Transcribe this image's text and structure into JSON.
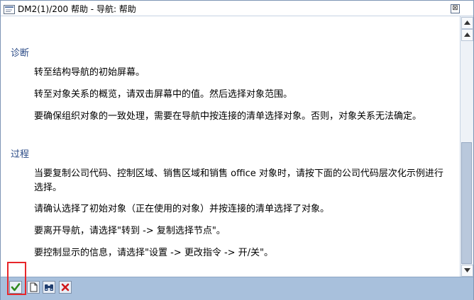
{
  "window": {
    "title": "DM2(1)/200 帮助 - 导航: 帮助",
    "close_glyph": "⊠"
  },
  "content": {
    "sections": [
      {
        "heading": "诊断",
        "paragraphs": [
          "转至结构导航的初始屏幕。",
          "转至对象关系的概览，请双击屏幕中的值。然后选择对象范围。",
          "要确保组织对象的一致处理，需要在导航中按连接的清单选择对象。否则，对象关系无法确定。"
        ]
      },
      {
        "heading": "过程",
        "paragraphs": [
          "当要复制公司代码、控制区域、销售区域和销售 office 对象时，请按下面的公司代码层次化示例进行选择。",
          "请确认选择了初始对象（正在使用的对象）并按连接的清单选择了对象。",
          "要离开导航，请选择\"转到 -> 复制选择节点\"。",
          "要控制显示的信息，请选择\"设置 -> 更改指令 -> 开/关\"。"
        ]
      }
    ]
  },
  "toolbar": {
    "buttons": [
      {
        "icon": "checkmark-icon",
        "name": "continue-button"
      },
      {
        "icon": "document-icon",
        "name": "display-document-button"
      },
      {
        "icon": "binoculars-icon",
        "name": "find-button"
      },
      {
        "icon": "cancel-x-icon",
        "name": "cancel-button"
      }
    ]
  },
  "colors": {
    "toolbar_bg": "#a8c0dc",
    "heading": "#2a4a86",
    "highlight": "#e8262a",
    "check_green": "#2f8a1e",
    "cancel_red": "#d0191b"
  }
}
